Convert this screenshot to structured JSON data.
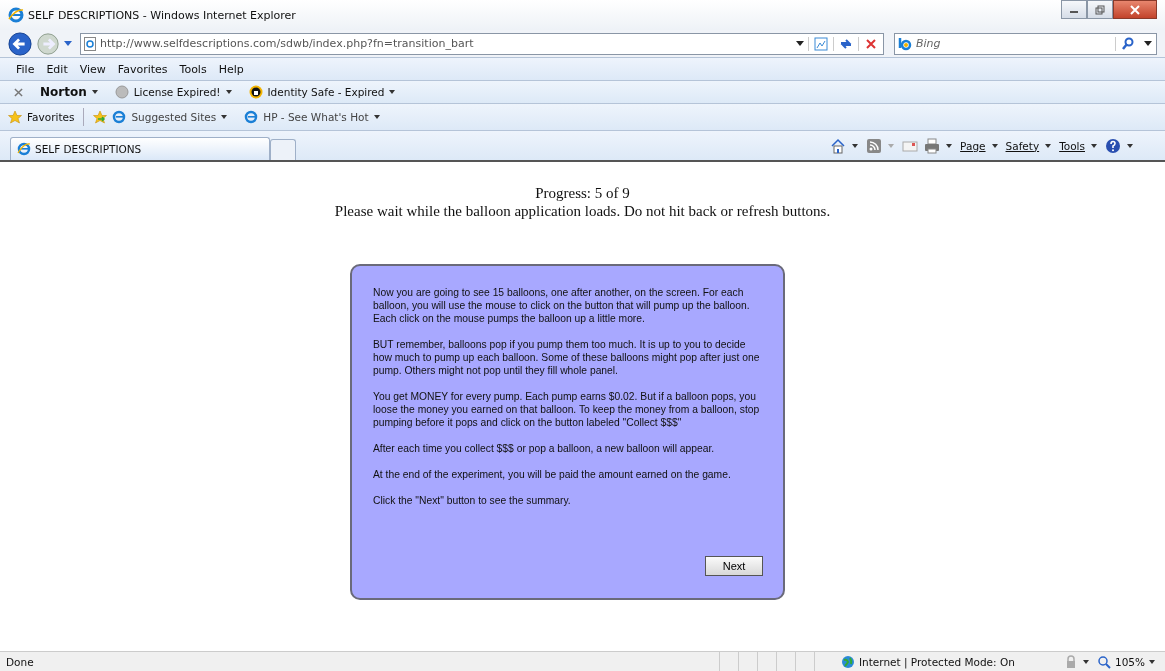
{
  "window": {
    "title": "SELF DESCRIPTIONS - Windows Internet Explorer"
  },
  "address_bar": {
    "url": "http://www.selfdescriptions.com/sdwb/index.php?fn=transition_bart"
  },
  "search": {
    "placeholder": "Bing"
  },
  "menu": [
    "File",
    "Edit",
    "View",
    "Favorites",
    "Tools",
    "Help"
  ],
  "norton_bar": {
    "brand": "Norton",
    "items": [
      "License Expired!",
      "Identity Safe - Expired"
    ]
  },
  "favorites_bar": {
    "label": "Favorites",
    "items": [
      "Suggested Sites",
      "HP - See What's Hot"
    ]
  },
  "tabs": [
    {
      "label": "SELF DESCRIPTIONS",
      "selected": true
    }
  ],
  "command_bar": [
    "Page",
    "Safety",
    "Tools"
  ],
  "page": {
    "progress": "Progress: 5 of 9",
    "notice": "Please wait while the balloon application loads. Do not hit back or refresh buttons.",
    "paragraphs": [
      "Now you are going to see 15 balloons, one after another, on the screen. For each balloon, you will use the mouse to click on the button that will pump up the balloon. Each click on the mouse pumps the balloon up a little more.",
      "BUT remember, balloons pop if you pump them too much. It is up to you to decide how much to pump up each balloon. Some of these balloons might pop after just one pump. Others might not pop until they fill whole panel.",
      "You get MONEY for every pump. Each pump earns $0.02. But if a balloon pops, you loose the money you earned on that balloon. To keep the money from a balloon, stop pumping before it pops and click on the button labeled \"Collect $$$\"",
      "After each time you collect $$$ or pop a balloon, a new balloon will appear.",
      "At the end of the experiment, you will be paid the amount earned on the game.",
      "Click the \"Next\" button to see the summary."
    ],
    "button": "Next"
  },
  "status_bar": {
    "status": "Done",
    "zone": "Internet | Protected Mode: On",
    "zoom": "105%"
  }
}
